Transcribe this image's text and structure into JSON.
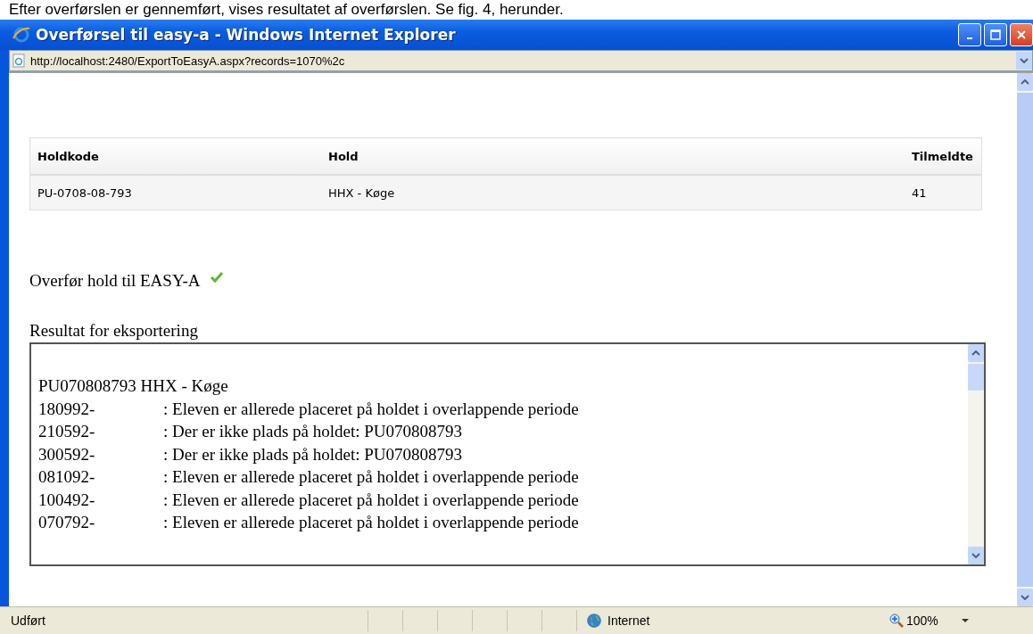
{
  "caption": "Efter overførslen er gennemført, vises resultatet af overførslen. Se fig. 4, herunder.",
  "window": {
    "title": "Overførsel til easy-a - Windows Internet Explorer"
  },
  "address": "http://localhost:2480/ExportToEasyA.aspx?records=1070%2c",
  "table": {
    "columns": [
      "Holdkode",
      "Hold",
      "Tilmeldte"
    ],
    "rows": [
      [
        "PU-0708-08-793",
        "HHX - Køge",
        "41"
      ]
    ]
  },
  "transfer": {
    "label": "Overfør hold til EASY-A",
    "done": true
  },
  "result": {
    "label": "Resultat for eksportering",
    "heading": "PU070808793 HHX - Køge",
    "lines": [
      {
        "id": "180992-",
        "message": ": Eleven er allerede placeret på holdet i overlappende periode"
      },
      {
        "id": "210592-",
        "message": ": Der er ikke plads på holdet: PU070808793"
      },
      {
        "id": "300592-",
        "message": ": Der er ikke plads på holdet: PU070808793"
      },
      {
        "id": "081092-",
        "message": ": Eleven er allerede placeret på holdet i overlappende periode"
      },
      {
        "id": "100492-",
        "message": ": Eleven er allerede placeret på holdet i overlappende periode"
      },
      {
        "id": "070792-",
        "message": ": Eleven er allerede placeret på holdet i overlappende periode"
      }
    ]
  },
  "status_bar": {
    "text": "Udført",
    "zone": "Internet",
    "zoom": "100%"
  }
}
